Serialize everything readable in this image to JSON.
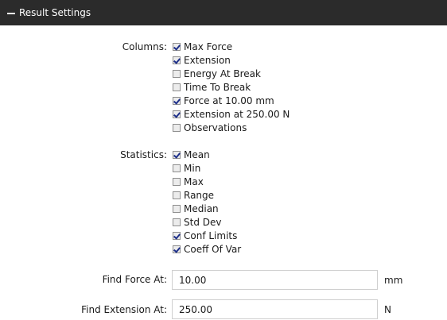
{
  "panel": {
    "title": "Result Settings"
  },
  "columns": {
    "label": "Columns:",
    "options": [
      {
        "label": "Max Force",
        "checked": true
      },
      {
        "label": "Extension",
        "checked": true
      },
      {
        "label": "Energy At Break",
        "checked": false
      },
      {
        "label": "Time To Break",
        "checked": false
      },
      {
        "label": "Force at 10.00 mm",
        "checked": true
      },
      {
        "label": "Extension at 250.00 N",
        "checked": true
      },
      {
        "label": "Observations",
        "checked": false
      }
    ]
  },
  "statistics": {
    "label": "Statistics:",
    "options": [
      {
        "label": "Mean",
        "checked": true
      },
      {
        "label": "Min",
        "checked": false
      },
      {
        "label": "Max",
        "checked": false
      },
      {
        "label": "Range",
        "checked": false
      },
      {
        "label": "Median",
        "checked": false
      },
      {
        "label": "Std Dev",
        "checked": false
      },
      {
        "label": "Conf Limits",
        "checked": true
      },
      {
        "label": "Coeff Of Var",
        "checked": true
      }
    ]
  },
  "find_force": {
    "label": "Find Force At:",
    "value": "10.00",
    "unit": "mm"
  },
  "find_extension": {
    "label": "Find Extension At:",
    "value": "250.00",
    "unit": "N"
  }
}
